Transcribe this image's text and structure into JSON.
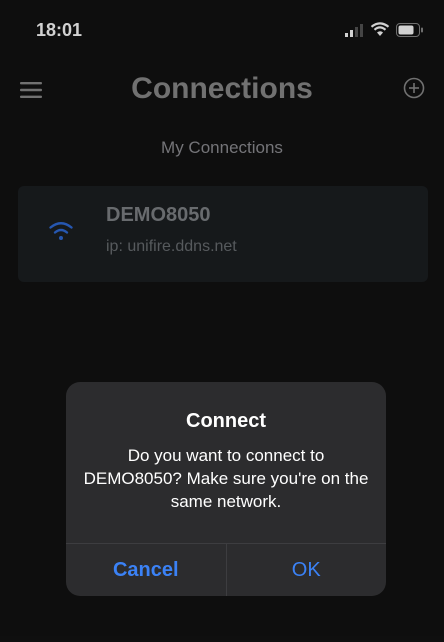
{
  "status_bar": {
    "time": "18:01",
    "icons": [
      "cellular-signal-icon",
      "wifi-icon",
      "battery-icon"
    ]
  },
  "header": {
    "title": "Connections",
    "left_icon": "hamburger-menu-icon",
    "right_icon": "add-circle-icon"
  },
  "section": {
    "label": "My Connections"
  },
  "connections": [
    {
      "name": "DEMO8050",
      "ip": "ip: unifire.ddns.net",
      "icon": "wifi-icon"
    }
  ],
  "alert": {
    "title": "Connect",
    "message": "Do you want to connect to DEMO8050? Make sure you're on the same network.",
    "cancel_label": "Cancel",
    "ok_label": "OK"
  },
  "colors": {
    "background": "#121212",
    "accent": "#3b82f6",
    "card": "#1c1f22",
    "alert_bg": "#2c2c2e"
  }
}
